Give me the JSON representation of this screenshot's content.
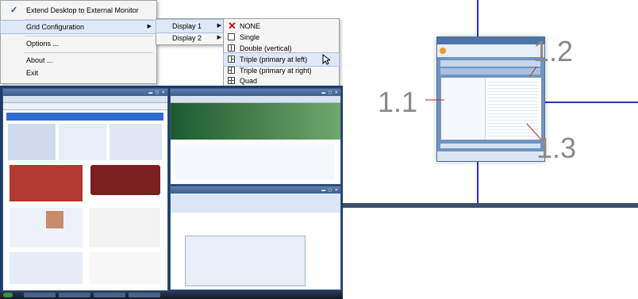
{
  "menu": {
    "items": [
      {
        "label": "Extend Desktop to External Monitor",
        "checked": true
      },
      {
        "label": "Grid Configuration",
        "submenu": true
      },
      {
        "label": "Options ..."
      },
      {
        "label": "About ..."
      },
      {
        "label": "Exit"
      }
    ],
    "check_glyph": "✓",
    "submenu_arrow": "▶"
  },
  "displays": {
    "items": [
      {
        "label": "Display 1",
        "highlighted": true
      },
      {
        "label": "Display 2"
      }
    ]
  },
  "grid_options": {
    "items": [
      {
        "label": "NONE",
        "icon": "red-x-icon"
      },
      {
        "label": "Single",
        "icon": "single-grid-icon"
      },
      {
        "label": "Double (vertical)",
        "icon": "double-vertical-grid-icon"
      },
      {
        "label": "Triple (primary at left)",
        "icon": "triple-left-grid-icon",
        "highlighted": true
      },
      {
        "label": "Triple (primary at right)",
        "icon": "triple-right-grid-icon"
      },
      {
        "label": "Quad",
        "icon": "quad-grid-icon"
      }
    ]
  },
  "zones": {
    "label_1": "1.1",
    "label_2": "1.2",
    "label_3": "1.3"
  },
  "colors": {
    "grid_line": "#2a33b8",
    "menu_highlight": "#dfe8f6",
    "check": "#1b4ea8",
    "none_x": "#d40000"
  }
}
